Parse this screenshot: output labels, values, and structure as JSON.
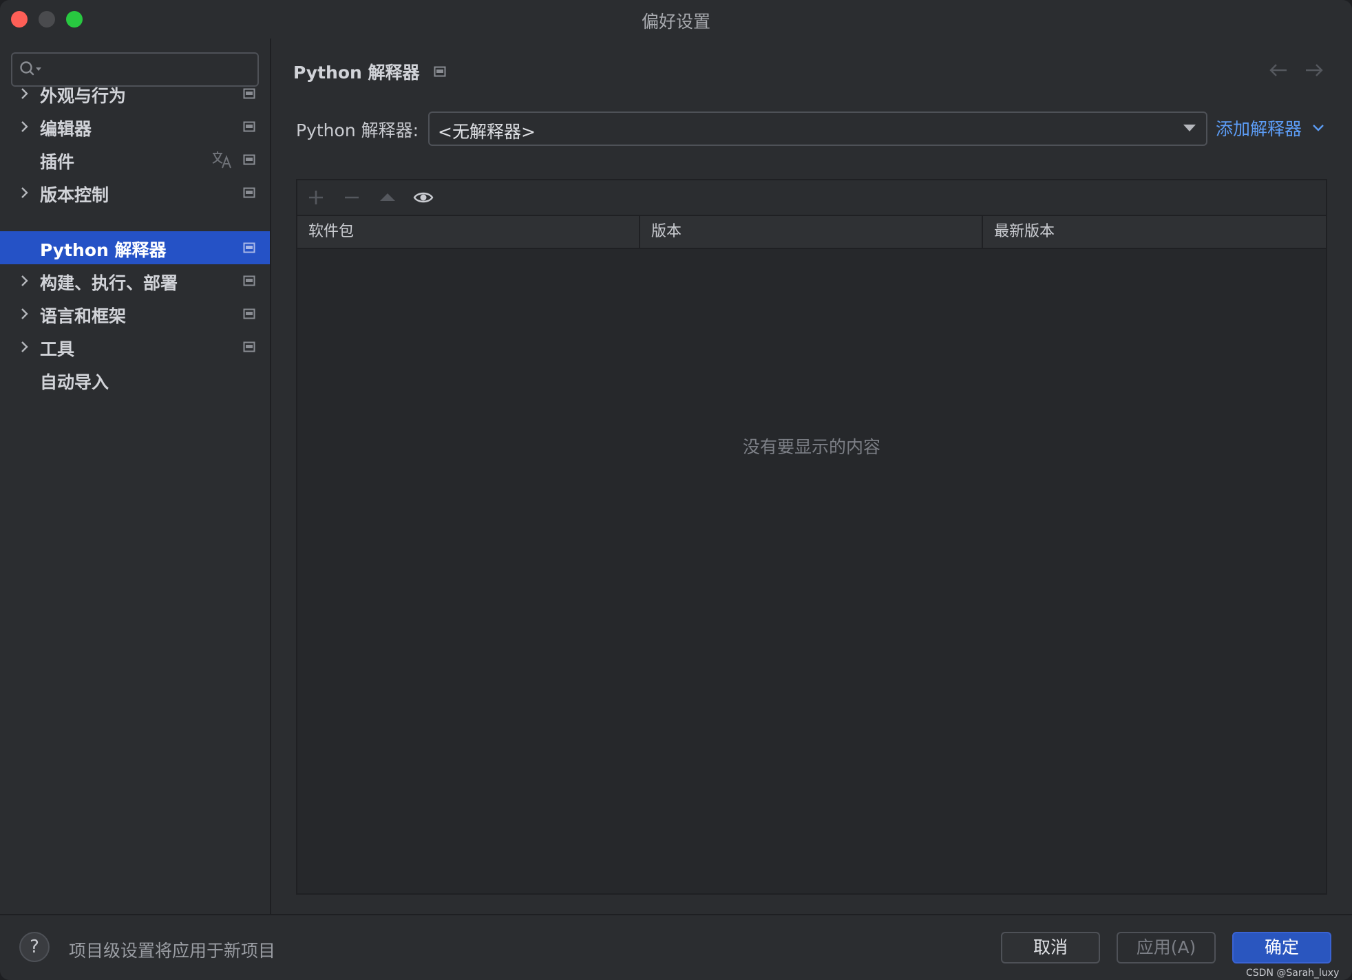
{
  "window": {
    "title": "偏好设置"
  },
  "sidebar": {
    "search": {
      "value": "",
      "placeholder": ""
    },
    "items": [
      {
        "label": "外观与行为",
        "expandable": true,
        "selected": false
      },
      {
        "label": "编辑器",
        "expandable": true,
        "selected": false
      },
      {
        "label": "插件",
        "expandable": false,
        "selected": false
      },
      {
        "label": "版本控制",
        "expandable": true,
        "selected": false
      },
      {
        "label": "Python 解释器",
        "expandable": false,
        "selected": true
      },
      {
        "label": "构建、执行、部署",
        "expandable": true,
        "selected": false
      },
      {
        "label": "语言和框架",
        "expandable": true,
        "selected": false
      },
      {
        "label": "工具",
        "expandable": true,
        "selected": false
      },
      {
        "label": "自动导入",
        "expandable": false,
        "selected": false
      }
    ]
  },
  "main": {
    "title": "Python 解释器",
    "interpreter": {
      "label": "Python 解释器:",
      "value": "<无解释器>",
      "add_label": "添加解释器"
    },
    "packages": {
      "columns": [
        "软件包",
        "版本",
        "最新版本"
      ],
      "rows": [],
      "empty_text": "没有要显示的内容"
    }
  },
  "footer": {
    "help_label": "?",
    "note": "项目级设置将应用于新项目",
    "cancel_label": "取消",
    "apply_label": "应用(A)",
    "ok_label": "确定",
    "watermark": "CSDN @Sarah_luxy"
  },
  "colors": {
    "background": "#2b2d30",
    "selection": "#2552c6",
    "link": "#5c9cf5",
    "close": "#fe5f57",
    "maximize": "#28c840"
  }
}
